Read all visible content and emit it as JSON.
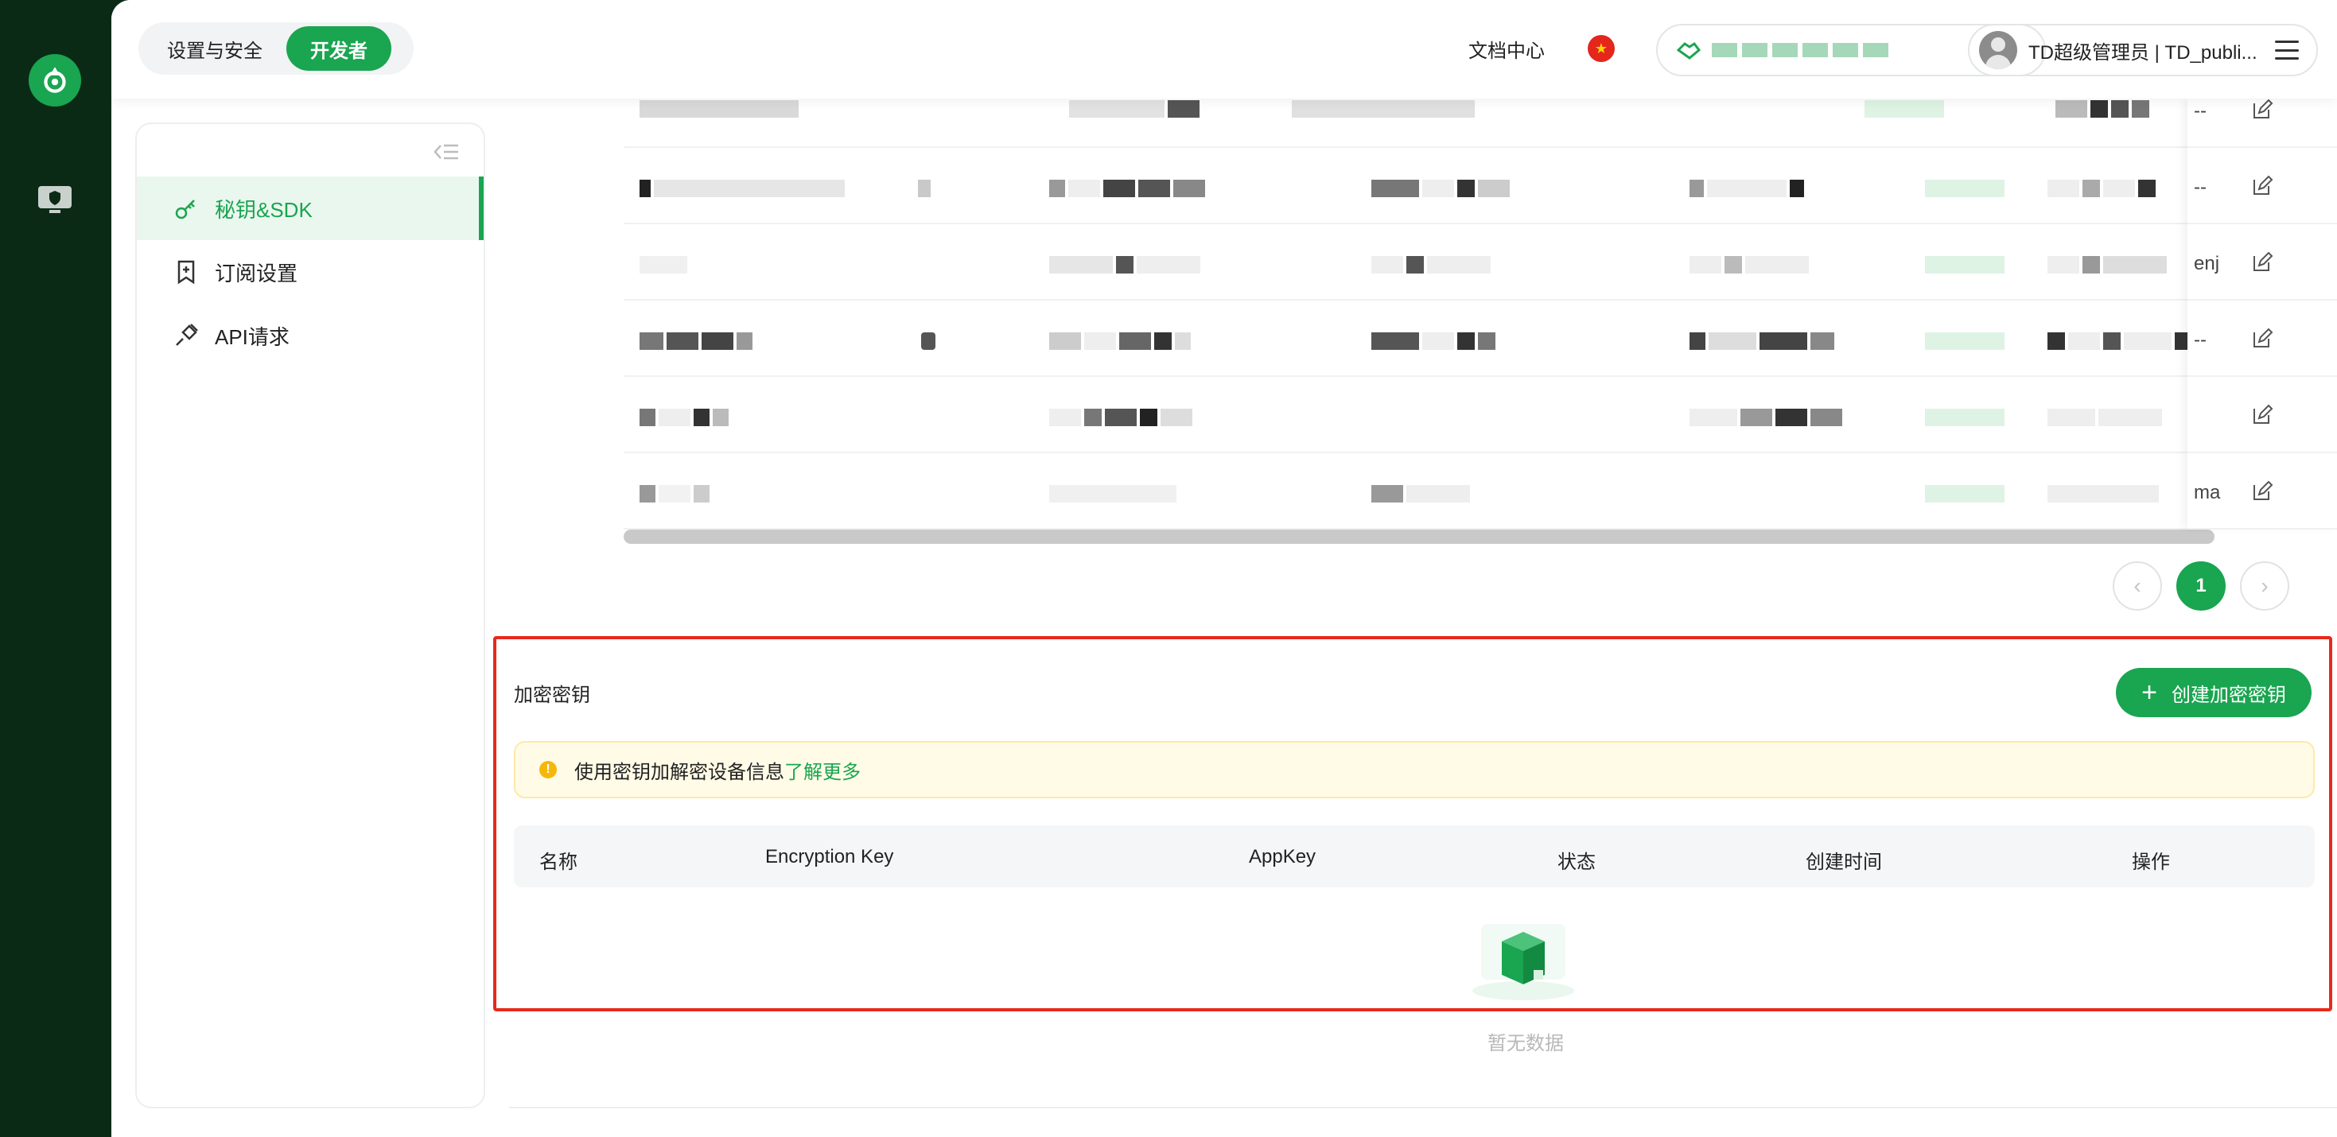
{
  "header": {
    "tabs": [
      {
        "label": "设置与安全",
        "active": false
      },
      {
        "label": "开发者",
        "active": true
      }
    ],
    "doc_center": "文档中心",
    "user_name": "TD超级管理员 | TD_publi..."
  },
  "sidenav": {
    "items": [
      {
        "label": "秘钥&SDK",
        "icon": "key-icon",
        "active": true
      },
      {
        "label": "订阅设置",
        "icon": "bookmark-plus-icon",
        "active": false
      },
      {
        "label": "API请求",
        "icon": "plug-icon",
        "active": false
      }
    ]
  },
  "app_table": {
    "op_cells": [
      "--",
      "--",
      "enj",
      "--",
      "",
      "ma"
    ]
  },
  "pagination": {
    "current_page": "1",
    "prev": "‹",
    "next": "›"
  },
  "encryption": {
    "title": "加密密钥",
    "create_button": "创建加密密钥",
    "alert_text": "使用密钥加解密设备信息",
    "alert_link": "了解更多",
    "columns": [
      "名称",
      "Encryption Key",
      "AppKey",
      "状态",
      "创建时间",
      "操作"
    ],
    "empty_text": "暂无数据"
  },
  "colors": {
    "brand": "#1aa550",
    "highlight_border": "#e8291c",
    "alert_bg": "#fffbe6"
  }
}
